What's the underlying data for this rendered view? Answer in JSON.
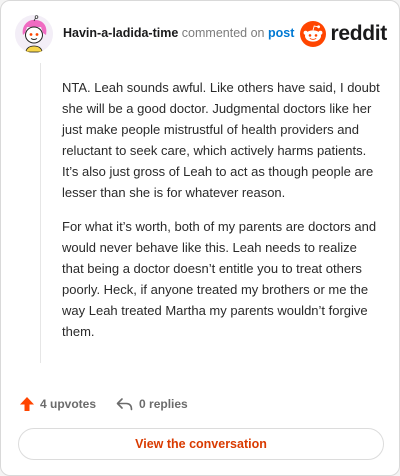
{
  "header": {
    "username": "Havin-a-ladida-time",
    "action_text": "commented on",
    "post_link": "post",
    "brand": "reddit"
  },
  "comment": {
    "paragraphs": [
      "NTA. Leah sounds awful. Like others have said, I doubt she will be a good doctor. Judgmental doctors like her just make people mistrustful of health providers and reluctant to seek care, which actively harms patients. It’s also just gross of Leah to act as though people are lesser than she is for whatever reason.",
      "For what it’s worth, both of my parents are doctors and would never behave like this. Leah needs to realize that being a doctor doesn’t entitle you to treat others poorly. Heck, if anyone treated my brothers or me the way Leah treated Martha my parents wouldn’t forgive them."
    ]
  },
  "actions": {
    "upvotes": "4 upvotes",
    "replies": "0 replies"
  },
  "footer": {
    "view_label": "View the conversation"
  },
  "colors": {
    "brand_orange": "#ff4500",
    "link_blue": "#0079d3",
    "cta_orange": "#d93a00"
  },
  "icons": {
    "avatar": "snoo-avatar",
    "logo": "reddit-snoo-icon",
    "upvote": "upvote-arrow-icon",
    "reply": "reply-arrow-icon"
  }
}
